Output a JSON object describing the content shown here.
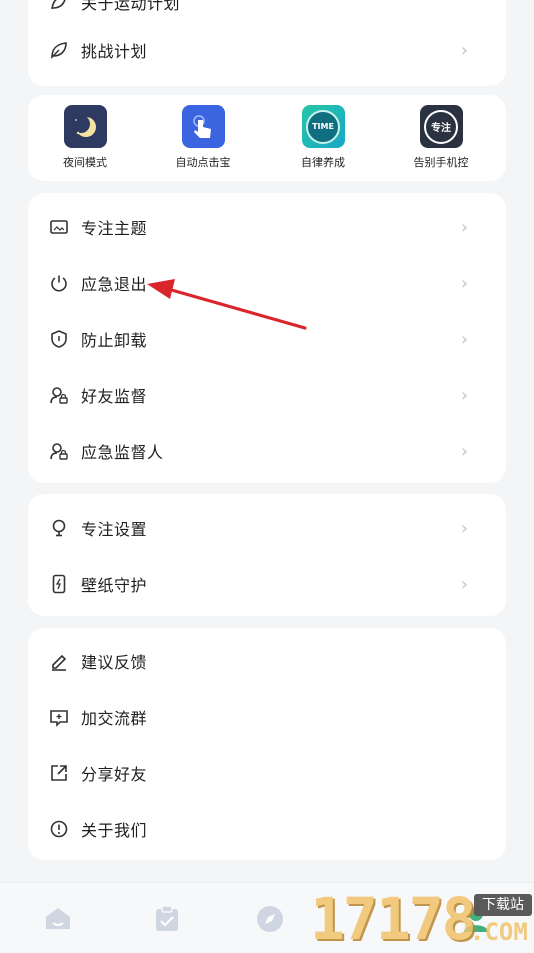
{
  "card1": {
    "top_item_label": "关于运动计划",
    "challenge_label": "挑战计划"
  },
  "apps": [
    {
      "name": "夜间模式"
    },
    {
      "name": "自动点击宝"
    },
    {
      "name": "自律养成",
      "tile_text": "TIME"
    },
    {
      "name": "告别手机控",
      "tile_text": "专注"
    }
  ],
  "card3": {
    "items": [
      {
        "label": "专注主题"
      },
      {
        "label": "应急退出"
      },
      {
        "label": "防止卸载"
      },
      {
        "label": "好友监督"
      },
      {
        "label": "应急监督人"
      }
    ]
  },
  "card4": {
    "items": [
      {
        "label": "专注设置"
      },
      {
        "label": "壁纸守护"
      }
    ]
  },
  "card5": {
    "items": [
      {
        "label": "建议反馈"
      },
      {
        "label": "加交流群"
      },
      {
        "label": "分享好友"
      },
      {
        "label": "关于我们"
      }
    ]
  },
  "watermark": {
    "digits": "17178",
    "tag": "下载站",
    "domain": ".COM"
  },
  "colors": {
    "accent_arrow": "#d9262b",
    "card_bg": "#ffffff",
    "page_bg": "#f4f5f7"
  }
}
